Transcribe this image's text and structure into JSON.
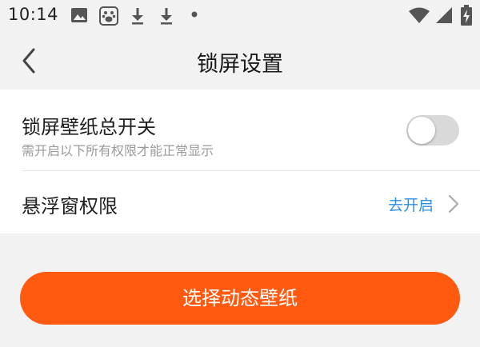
{
  "status_bar": {
    "time": "10:14",
    "icons": [
      "image-icon",
      "baidu-paw-icon",
      "download-icon",
      "download-icon",
      "notification-dot-icon",
      "wifi-icon",
      "signal-icon",
      "battery-charging-icon"
    ]
  },
  "header": {
    "title": "锁屏设置",
    "back_icon": "chevron-left-icon"
  },
  "settings": {
    "master_switch": {
      "label": "锁屏壁纸总开关",
      "sublabel": "需开启以下所有权限才能正常显示",
      "enabled": false
    },
    "float_window": {
      "label": "悬浮窗权限",
      "action": "去开启",
      "icon": "chevron-right-icon"
    }
  },
  "primary_button": {
    "label": "选择动态壁纸"
  },
  "colors": {
    "accent_orange": "#ff5a0f",
    "link_blue": "#2f8ee0",
    "background": "#f2f2f2"
  }
}
